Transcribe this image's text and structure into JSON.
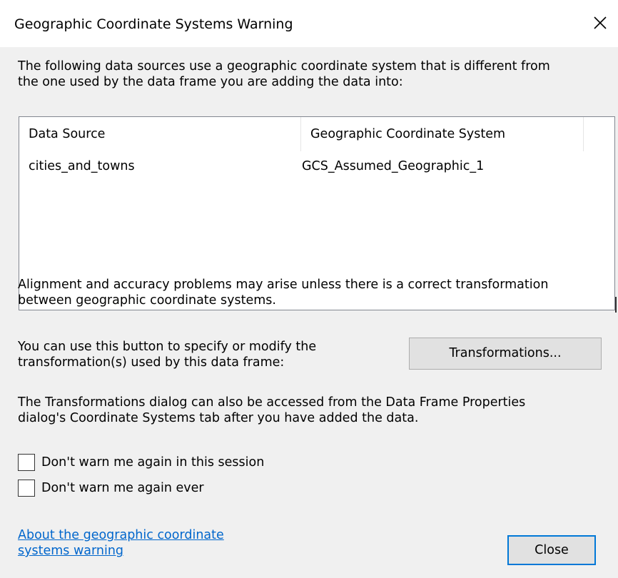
{
  "window": {
    "title": "Geographic Coordinate Systems Warning"
  },
  "intro": {
    "line1": "The following data sources use a geographic coordinate system that is different from",
    "line2": "the one used by the data frame you are adding the data into:"
  },
  "table": {
    "columns": [
      "Data Source",
      "Geographic Coordinate System"
    ],
    "rows": [
      [
        "cities_and_towns",
        "GCS_Assumed_Geographic_1"
      ]
    ]
  },
  "alignment": {
    "line1": "Alignment and accuracy problems may arise unless there is a correct transformation",
    "line2": "between geographic coordinate systems."
  },
  "transform_section": {
    "line1": "You can use this button to specify or modify the",
    "line2": "transformation(s) used by this data frame:",
    "button_label": "Transformations..."
  },
  "dialog_note": {
    "line1": "The Transformations dialog can also be accessed from the Data Frame Properties",
    "line2": "dialog's Coordinate Systems tab after you have added the data."
  },
  "checkboxes": [
    {
      "label": "Don't warn me again in this session",
      "checked": false
    },
    {
      "label": "Don't warn me again ever",
      "checked": false
    }
  ],
  "link": {
    "line1": "About the geographic coordinate",
    "line2": "systems warning"
  },
  "footer": {
    "close_label": "Close"
  },
  "icons": {
    "close": "close-icon"
  },
  "colors": {
    "client_bg": "#f0f0f0",
    "link": "#0066cc",
    "default_button_border": "#0078d7"
  }
}
